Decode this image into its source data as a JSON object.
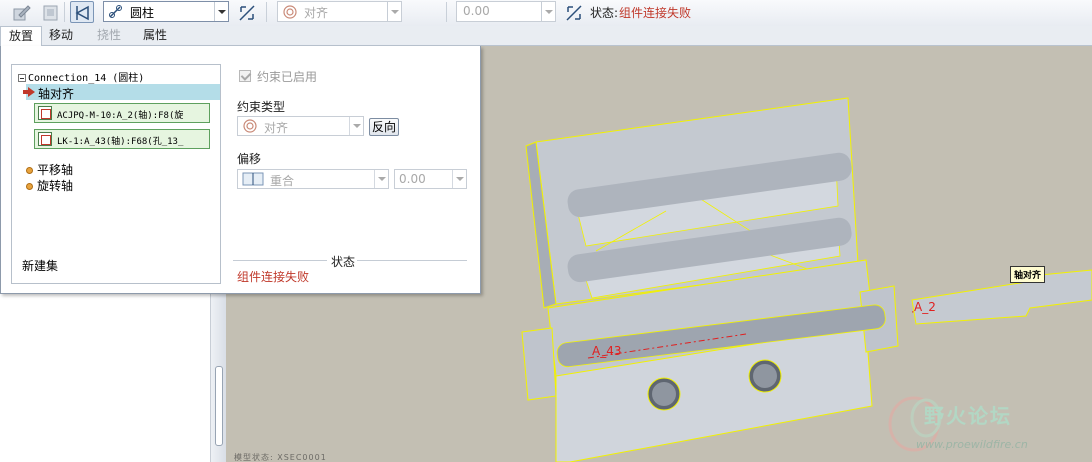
{
  "toolbar": {
    "constraint_set_type": "圆柱",
    "constraint_type": "对齐",
    "offset_value": "0.00",
    "status_label": "状态:",
    "status_value": "组件连接失败",
    "icons": [
      "constraint-edit-icon",
      "component-window-icon",
      "user-defined-set-icon",
      "cylinder-set-icon",
      "flip-icon",
      "align-icon",
      "offset-flip-icon"
    ]
  },
  "tabs": [
    {
      "label": "放置",
      "active": true
    },
    {
      "label": "移动"
    },
    {
      "label": "挠性",
      "disabled": true
    },
    {
      "label": "属性"
    }
  ],
  "panel": {
    "tree": {
      "root": "Connection_14 (圆柱)",
      "selected": "轴对齐",
      "references": [
        "ACJPQ-M-10:A_2(轴):F8(旋",
        "LK-1:A_43(轴):F68(孔_13_"
      ],
      "motion_axes": [
        "平移轴",
        "旋转轴"
      ],
      "new_set": "新建集"
    },
    "constraint_enabled_label": "约束已启用",
    "constraint_type_label": "约束类型",
    "constraint_type_value": "对齐",
    "flip_button": "反向",
    "offset_label": "偏移",
    "offset_type_value": "重合",
    "offset_value": "0.00",
    "status_title": "状态",
    "status_value": "组件连接失败"
  },
  "viewport": {
    "axis_labels": [
      "A_2",
      "A_43"
    ],
    "constraint_tag": "轴对齐",
    "watermark_title": "野火论坛",
    "watermark_url": "www.proewildfire.cn",
    "footer": "模型状态: XSEC0001"
  },
  "colors": {
    "status_error": "#c0392b",
    "selection": "#b4dde8",
    "model_fill": "#c9ced6",
    "highlight": "#ffff00",
    "axis": "#e02020"
  }
}
